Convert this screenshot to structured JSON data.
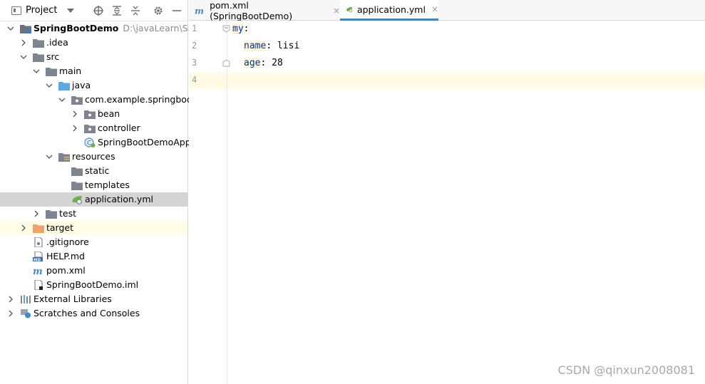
{
  "project_panel": {
    "title": "Project",
    "tree": [
      {
        "label": "SpringBootDemo",
        "hint": "D:\\javaLearn\\Sprir",
        "bold": true
      },
      {
        "label": ".idea"
      },
      {
        "label": "src"
      },
      {
        "label": "main"
      },
      {
        "label": "java"
      },
      {
        "label": "com.example.springboot"
      },
      {
        "label": "bean"
      },
      {
        "label": "controller"
      },
      {
        "label": "SpringBootDemoApp"
      },
      {
        "label": "resources"
      },
      {
        "label": "static"
      },
      {
        "label": "templates"
      },
      {
        "label": "application.yml"
      },
      {
        "label": "test"
      },
      {
        "label": "target"
      },
      {
        "label": ".gitignore"
      },
      {
        "label": "HELP.md"
      },
      {
        "label": "pom.xml"
      },
      {
        "label": "SpringBootDemo.iml"
      },
      {
        "label": "External Libraries"
      },
      {
        "label": "Scratches and Consoles"
      }
    ]
  },
  "tabs": [
    {
      "label": "pom.xml (SpringBootDemo)",
      "close": "×"
    },
    {
      "label": "application.yml",
      "close": "×"
    }
  ],
  "editor": {
    "line_numbers": [
      "1",
      "2",
      "3",
      "4"
    ],
    "lines": [
      {
        "key": "my",
        "sep": ":",
        "value": ""
      },
      {
        "key": "name",
        "sep": ":",
        "value": " lisi"
      },
      {
        "key": "age",
        "sep": ":",
        "value": " 28"
      }
    ]
  },
  "watermark": "CSDN @qinxun2008081"
}
